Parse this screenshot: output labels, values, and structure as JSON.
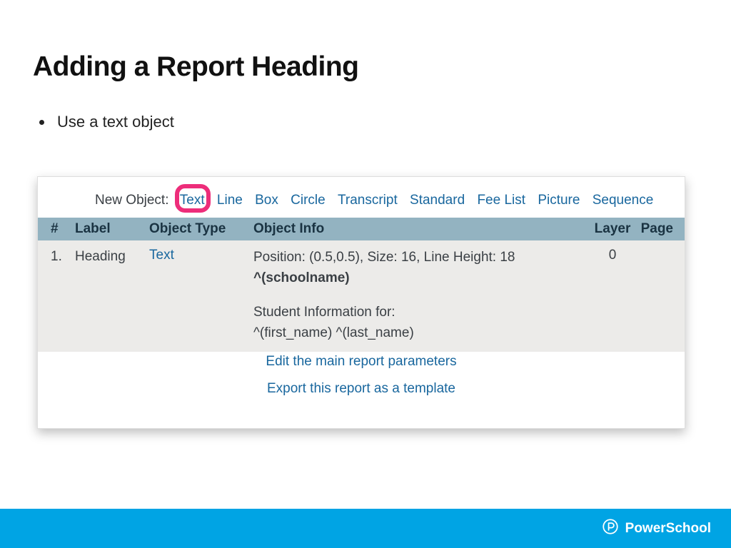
{
  "title": "Adding a Report Heading",
  "bullet": "Use a text object",
  "newObject": {
    "label": "New Object:",
    "options": [
      "Text",
      "Line",
      "Box",
      "Circle",
      "Transcript",
      "Standard",
      "Fee List",
      "Picture",
      "Sequence"
    ]
  },
  "columns": {
    "num": "#",
    "label": "Label",
    "type": "Object Type",
    "info": "Object Info",
    "layer": "Layer",
    "page": "Page"
  },
  "row": {
    "num": "1.",
    "label": "Heading",
    "typeLink": "Text",
    "info_line1": "Position: (0.5,0.5), Size: 16, Line Height: 18",
    "info_line2": "^(schoolname)",
    "info_line3": "Student Information for:",
    "info_line4": "^(first_name) ^(last_name)",
    "layer": "0",
    "page": ""
  },
  "footerLinks": {
    "edit": "Edit the main report parameters",
    "export": "Export this report as a template"
  },
  "brand": "PowerSchool"
}
